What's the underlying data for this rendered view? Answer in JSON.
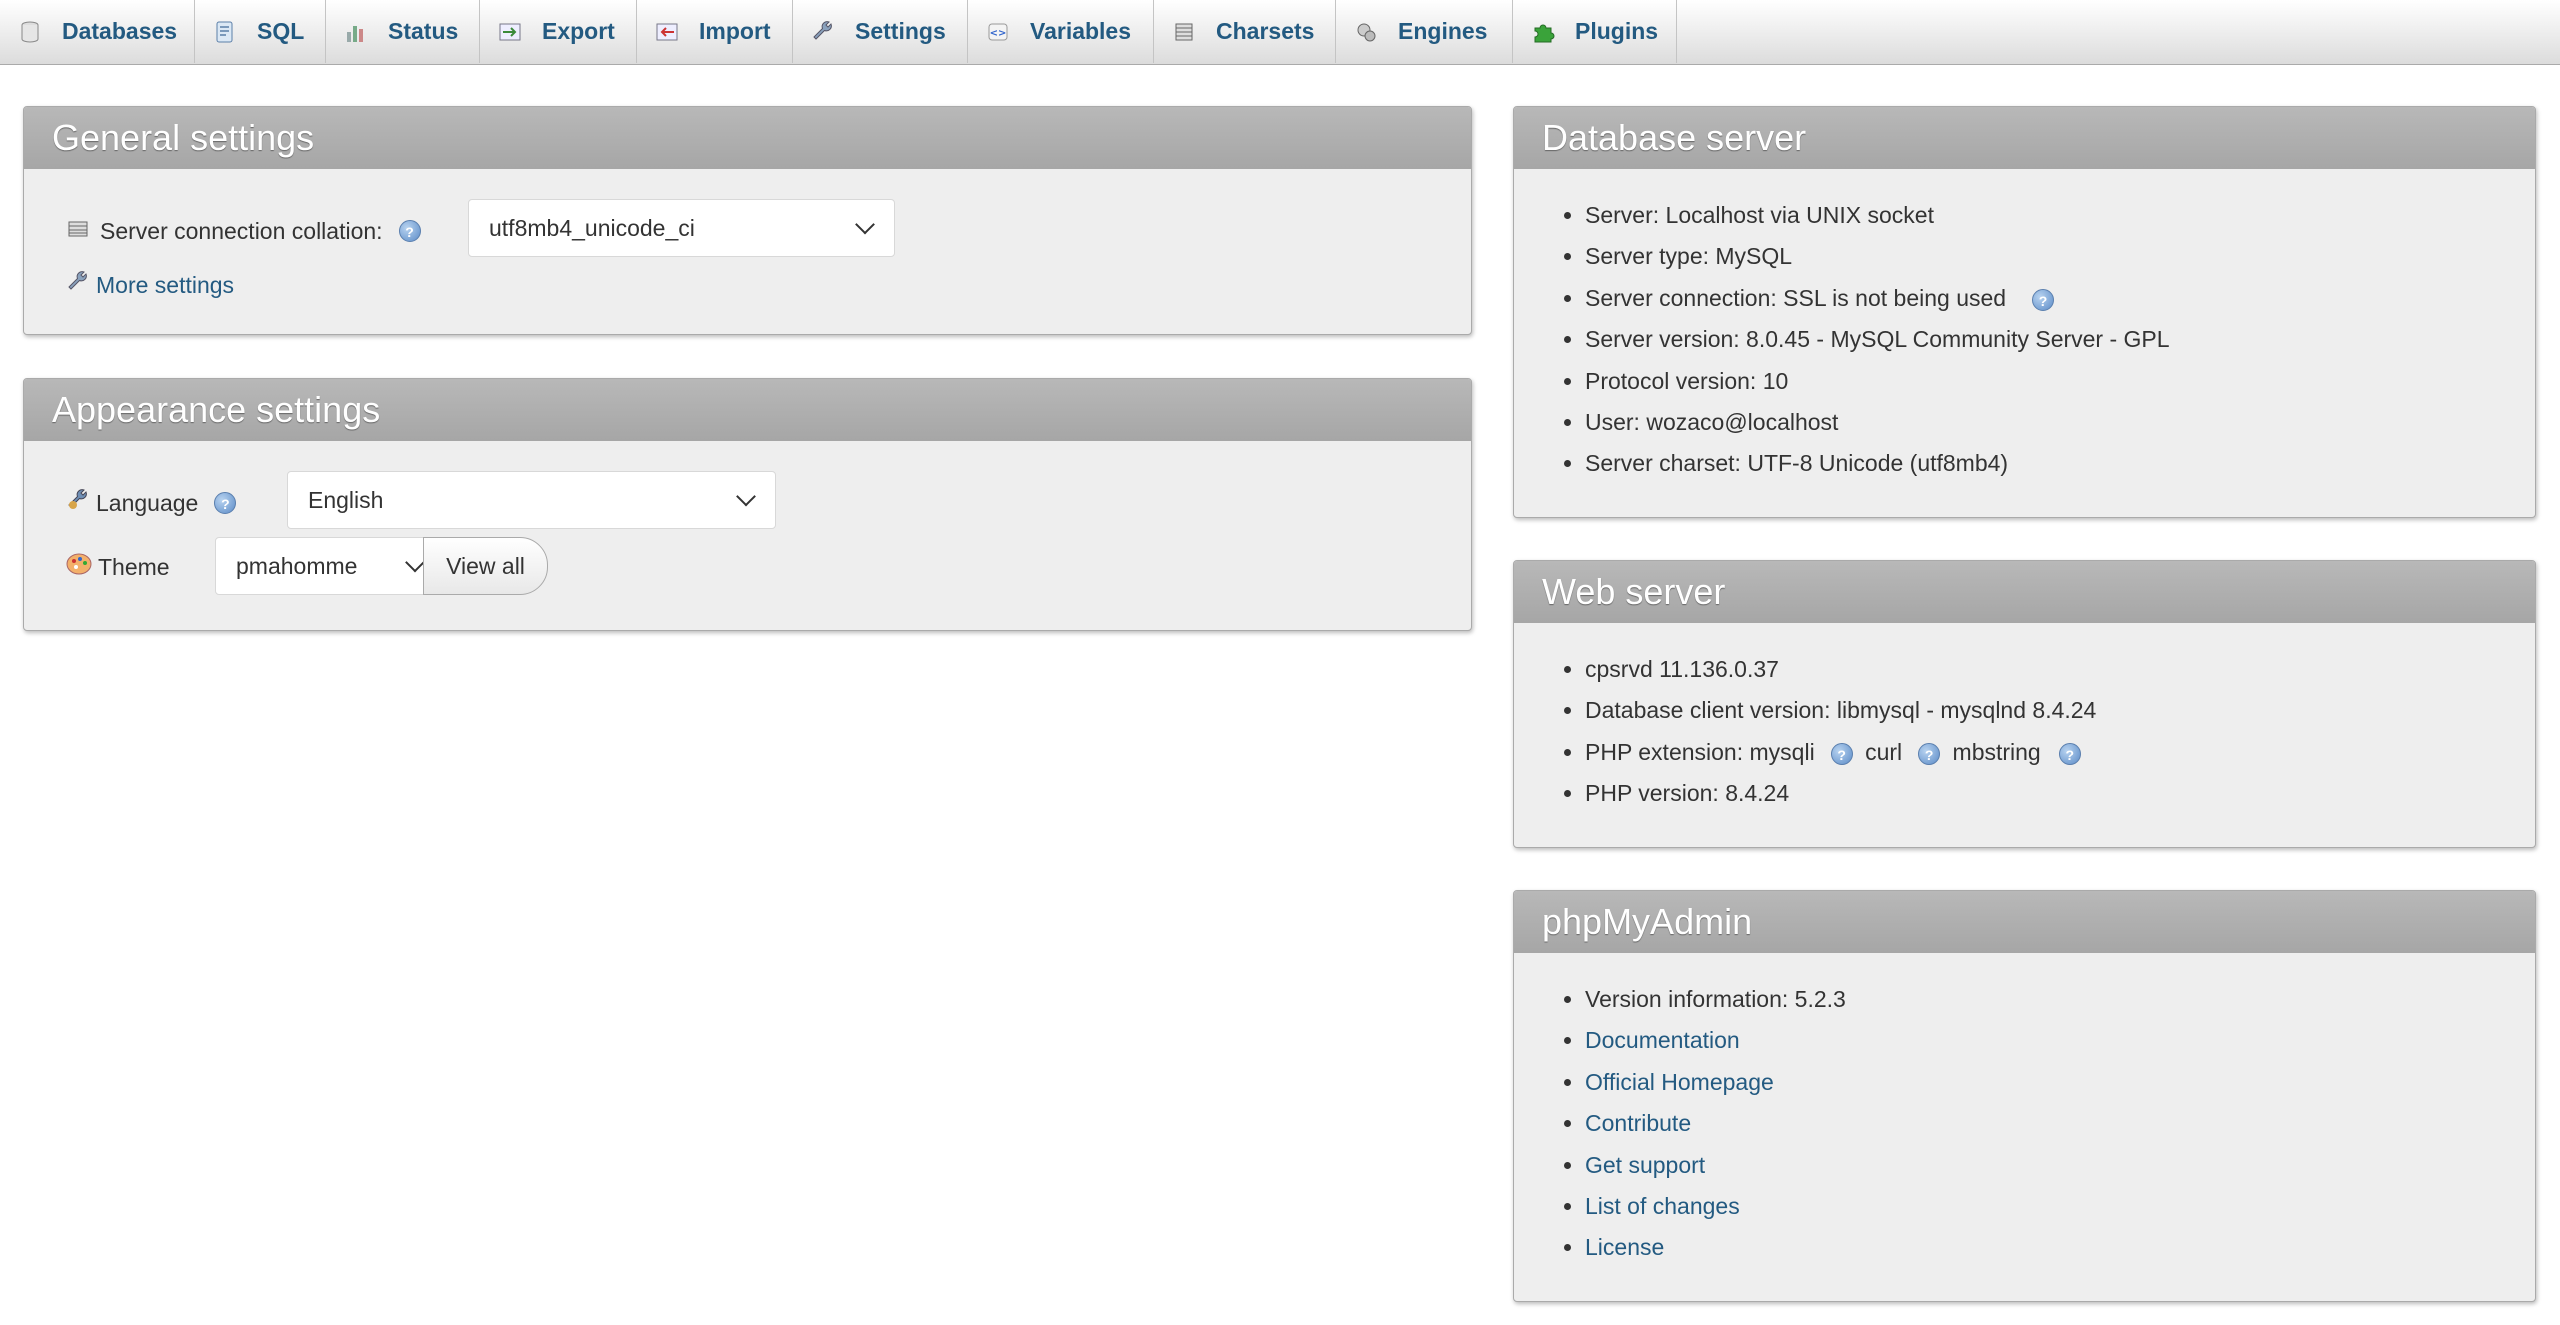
{
  "tabs": [
    {
      "label": "Databases",
      "icon": "database-icon"
    },
    {
      "label": "SQL",
      "icon": "sql-icon"
    },
    {
      "label": "Status",
      "icon": "status-icon"
    },
    {
      "label": "Export",
      "icon": "export-icon"
    },
    {
      "label": "Import",
      "icon": "import-icon"
    },
    {
      "label": "Settings",
      "icon": "wrench-icon"
    },
    {
      "label": "Variables",
      "icon": "variables-icon"
    },
    {
      "label": "Charsets",
      "icon": "charsets-icon"
    },
    {
      "label": "Engines",
      "icon": "engines-icon"
    },
    {
      "label": "Plugins",
      "icon": "puzzle-icon"
    }
  ],
  "general": {
    "title": "General settings",
    "collation_label": "Server connection collation:",
    "collation_value": "utf8mb4_unicode_ci",
    "more_settings": "More settings"
  },
  "appearance": {
    "title": "Appearance settings",
    "language_label": "Language",
    "language_value": "English",
    "theme_label": "Theme",
    "theme_value": "pmahomme",
    "view_all": "View all"
  },
  "db_server": {
    "title": "Database server",
    "items": [
      "Server: Localhost via UNIX socket",
      "Server type: MySQL",
      "Server connection: SSL is not being used",
      "Server version: 8.0.45 - MySQL Community Server - GPL",
      "Protocol version: 10",
      "User: wozaco@localhost",
      "Server charset: UTF-8 Unicode (utf8mb4)"
    ]
  },
  "web_server": {
    "title": "Web server",
    "items": [
      "cpsrvd 11.136.0.37",
      "Database client version: libmysql - mysqlnd 8.4.24",
      "PHP version: 8.4.24"
    ],
    "php_ext_prefix": "PHP extension: mysqli",
    "php_ext_curl": "curl",
    "php_ext_mbstring": "mbstring"
  },
  "pma": {
    "title": "phpMyAdmin",
    "version": "Version information: 5.2.3",
    "links": [
      "Documentation",
      "Official Homepage",
      "Contribute",
      "Get support",
      "List of changes",
      "License"
    ]
  },
  "help_glyph": "?",
  "colors": {
    "link": "#235a81",
    "panel_header": "#aaaaaa",
    "panel_bg": "#eeeeee"
  }
}
